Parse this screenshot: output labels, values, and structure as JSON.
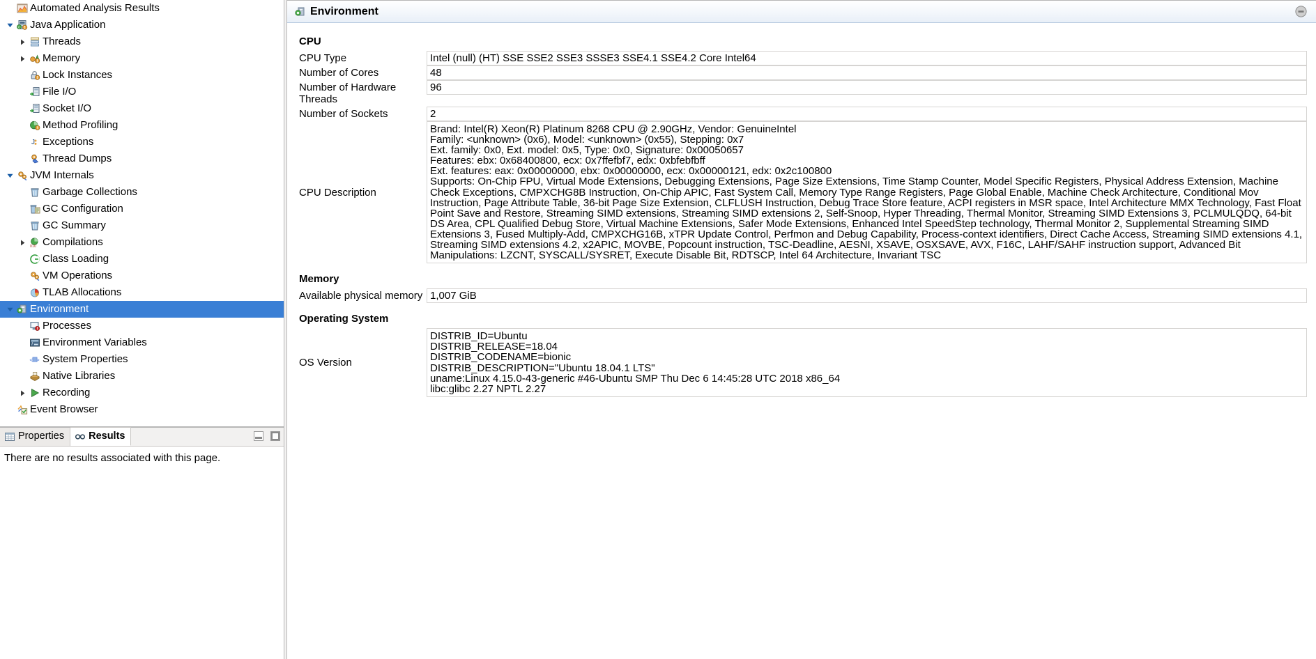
{
  "tree": {
    "items": [
      {
        "label": "Automated Analysis Results",
        "indent": 0,
        "twisty": "none",
        "icon": "analysis-results-icon",
        "selected": false
      },
      {
        "label": "Java Application",
        "indent": 0,
        "twisty": "expanded",
        "icon": "java-application-icon",
        "selected": false
      },
      {
        "label": "Threads",
        "indent": 1,
        "twisty": "collapsed",
        "icon": "threads-icon",
        "selected": false
      },
      {
        "label": "Memory",
        "indent": 1,
        "twisty": "collapsed",
        "icon": "memory-icon",
        "selected": false
      },
      {
        "label": "Lock Instances",
        "indent": 1,
        "twisty": "none",
        "icon": "lock-instances-icon",
        "selected": false
      },
      {
        "label": "File I/O",
        "indent": 1,
        "twisty": "none",
        "icon": "file-io-icon",
        "selected": false
      },
      {
        "label": "Socket I/O",
        "indent": 1,
        "twisty": "none",
        "icon": "socket-io-icon",
        "selected": false
      },
      {
        "label": "Method Profiling",
        "indent": 1,
        "twisty": "none",
        "icon": "method-profiling-icon",
        "selected": false
      },
      {
        "label": "Exceptions",
        "indent": 1,
        "twisty": "none",
        "icon": "exceptions-icon",
        "selected": false
      },
      {
        "label": "Thread Dumps",
        "indent": 1,
        "twisty": "none",
        "icon": "thread-dumps-icon",
        "selected": false
      },
      {
        "label": "JVM Internals",
        "indent": 0,
        "twisty": "expanded",
        "icon": "jvm-internals-icon",
        "selected": false
      },
      {
        "label": "Garbage Collections",
        "indent": 1,
        "twisty": "none",
        "icon": "garbage-collections-icon",
        "selected": false
      },
      {
        "label": "GC Configuration",
        "indent": 1,
        "twisty": "none",
        "icon": "gc-configuration-icon",
        "selected": false
      },
      {
        "label": "GC Summary",
        "indent": 1,
        "twisty": "none",
        "icon": "gc-summary-icon",
        "selected": false
      },
      {
        "label": "Compilations",
        "indent": 1,
        "twisty": "collapsed",
        "icon": "compilations-icon",
        "selected": false
      },
      {
        "label": "Class Loading",
        "indent": 1,
        "twisty": "none",
        "icon": "class-loading-icon",
        "selected": false
      },
      {
        "label": "VM Operations",
        "indent": 1,
        "twisty": "none",
        "icon": "vm-operations-icon",
        "selected": false
      },
      {
        "label": "TLAB Allocations",
        "indent": 1,
        "twisty": "none",
        "icon": "tlab-allocations-icon",
        "selected": false
      },
      {
        "label": "Environment",
        "indent": 0,
        "twisty": "expanded",
        "icon": "environment-icon",
        "selected": true
      },
      {
        "label": "Processes",
        "indent": 1,
        "twisty": "none",
        "icon": "processes-icon",
        "selected": false
      },
      {
        "label": "Environment Variables",
        "indent": 1,
        "twisty": "none",
        "icon": "environment-variables-icon",
        "selected": false
      },
      {
        "label": "System Properties",
        "indent": 1,
        "twisty": "none",
        "icon": "system-properties-icon",
        "selected": false
      },
      {
        "label": "Native Libraries",
        "indent": 1,
        "twisty": "none",
        "icon": "native-libraries-icon",
        "selected": false
      },
      {
        "label": "Recording",
        "indent": 1,
        "twisty": "collapsed",
        "icon": "recording-icon",
        "selected": false
      },
      {
        "label": "Event Browser",
        "indent": 0,
        "twisty": "none",
        "icon": "event-browser-icon",
        "selected": false
      }
    ]
  },
  "bottom_left": {
    "tabs": [
      {
        "label": "Properties",
        "icon": "properties-table-icon",
        "active": false
      },
      {
        "label": "Results",
        "icon": "results-glasses-icon",
        "active": true
      }
    ],
    "minimize_title": "Minimize",
    "maximize_title": "Maximize",
    "body_text": "There are no results associated with this page."
  },
  "editor": {
    "title": "Environment",
    "icon": "environment-icon",
    "minimize_title": "Minimize",
    "sections": {
      "cpu": "CPU",
      "memory": "Memory",
      "operating_system": "Operating System"
    },
    "fields": {
      "cpu_type_label": "CPU Type",
      "cpu_type_value": "Intel (null) (HT) SSE SSE2 SSE3 SSSE3 SSE4.1 SSE4.2 Core Intel64",
      "cores_label": "Number of Cores",
      "cores_value": "48",
      "hw_threads_label": "Number of Hardware Threads",
      "hw_threads_value": "96",
      "sockets_label": "Number of Sockets",
      "sockets_value": "2",
      "cpu_description_label": "CPU Description",
      "cpu_description_value": "Brand: Intel(R) Xeon(R) Platinum 8268 CPU @ 2.90GHz, Vendor: GenuineIntel\nFamily: <unknown> (0x6), Model: <unknown> (0x55), Stepping: 0x7\nExt. family: 0x0, Ext. model: 0x5, Type: 0x0, Signature: 0x00050657\nFeatures: ebx: 0x68400800, ecx: 0x7ffefbf7, edx: 0xbfebfbff\nExt. features: eax: 0x00000000, ebx: 0x00000000, ecx: 0x00000121, edx: 0x2c100800\nSupports: On-Chip FPU, Virtual Mode Extensions, Debugging Extensions, Page Size Extensions, Time Stamp Counter, Model Specific Registers, Physical Address Extension, Machine Check Exceptions, CMPXCHG8B Instruction, On-Chip APIC, Fast System Call, Memory Type Range Registers, Page Global Enable, Machine Check Architecture, Conditional Mov Instruction, Page Attribute Table, 36-bit Page Size Extension, CLFLUSH Instruction, Debug Trace Store feature, ACPI registers in MSR space, Intel Architecture MMX Technology, Fast Float Point Save and Restore, Streaming SIMD extensions, Streaming SIMD extensions 2, Self-Snoop, Hyper Threading, Thermal Monitor, Streaming SIMD Extensions 3, PCLMULQDQ, 64-bit DS Area, CPL Qualified Debug Store, Virtual Machine Extensions, Safer Mode Extensions, Enhanced Intel SpeedStep technology, Thermal Monitor 2, Supplemental Streaming SIMD Extensions 3, Fused Multiply-Add, CMPXCHG16B, xTPR Update Control, Perfmon and Debug Capability, Process-context identifiers, Direct Cache Access, Streaming SIMD extensions 4.1, Streaming SIMD extensions 4.2, x2APIC, MOVBE, Popcount instruction, TSC-Deadline, AESNI, XSAVE, OSXSAVE, AVX, F16C, LAHF/SAHF instruction support, Advanced Bit Manipulations: LZCNT, SYSCALL/SYSRET, Execute Disable Bit, RDTSCP, Intel 64 Architecture, Invariant TSC",
      "available_memory_label": "Available physical memory",
      "available_memory_value": "1,007 GiB",
      "os_version_label": "OS Version",
      "os_version_value": "DISTRIB_ID=Ubuntu\nDISTRIB_RELEASE=18.04\nDISTRIB_CODENAME=bionic\nDISTRIB_DESCRIPTION=\"Ubuntu 18.04.1 LTS\"\nuname:Linux 4.15.0-43-generic #46-Ubuntu SMP Thu Dec 6 14:45:28 UTC 2018 x86_64\nlibc:glibc 2.27 NPTL 2.27"
    }
  },
  "colors": {
    "selection": "#3a7fd5",
    "panel_border": "#b6b6b6",
    "field_border": "#d6d4d2",
    "header_gradient_end": "#e8eff8"
  }
}
